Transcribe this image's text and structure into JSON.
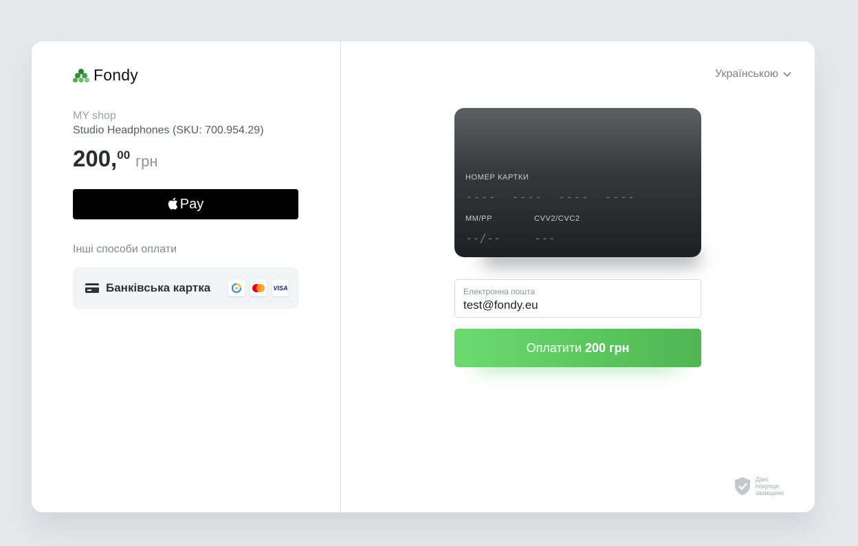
{
  "brand": {
    "name": "Fondy",
    "color": "#4caf50"
  },
  "order": {
    "shop": "MY shop",
    "product": "Studio Headphones (SKU: 700.954.29)",
    "amount_int": "200,",
    "amount_dec": "00",
    "currency": "грн"
  },
  "apple_pay": {
    "label": "Pay",
    "icon": "apple-icon"
  },
  "other_methods": {
    "title": "Інші способи оплати",
    "bank_card_label": "Банківська картка",
    "badges": [
      "prostir-icon",
      "mastercard-icon",
      "visa-icon"
    ],
    "visa_text": "VISA"
  },
  "language": {
    "selected": "Українською"
  },
  "card": {
    "number_label": "НОМЕР КАРТКИ",
    "number_placeholder": "----  ----  ----  ----",
    "expiry_label": "ММ/РР",
    "expiry_placeholder": "--/--",
    "cvv_label": "CVV2/CVC2",
    "cvv_placeholder": "---"
  },
  "email": {
    "label": "Електронна пошта",
    "value": "test@fondy.eu"
  },
  "pay_button": {
    "prefix": "Оплатити",
    "amount": "200 грн",
    "color": "#5cc75f"
  },
  "security": {
    "text": "Дані покупця захищено"
  }
}
